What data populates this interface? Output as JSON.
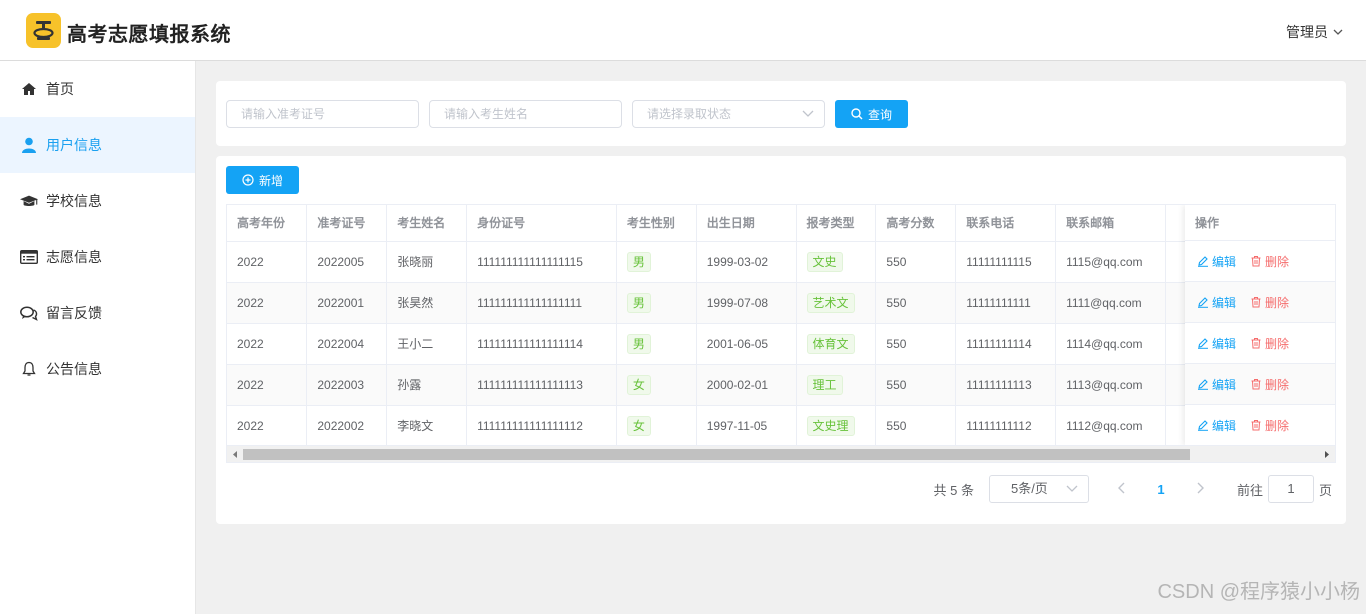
{
  "app": {
    "title": "高考志愿填报系统",
    "user": "管理员"
  },
  "sidebar": {
    "items": [
      {
        "label": "首页",
        "icon": "home-icon"
      },
      {
        "label": "用户信息",
        "icon": "user-icon",
        "active": true
      },
      {
        "label": "学校信息",
        "icon": "graduation-cap-icon"
      },
      {
        "label": "志愿信息",
        "icon": "list-card-icon"
      },
      {
        "label": "留言反馈",
        "icon": "chat-icon"
      },
      {
        "label": "公告信息",
        "icon": "bell-icon"
      }
    ]
  },
  "search": {
    "exam_no_placeholder": "请输入准考证号",
    "name_placeholder": "请输入考生姓名",
    "status_placeholder": "请选择录取状态",
    "search_label": "查询"
  },
  "toolbar": {
    "add_label": "新增"
  },
  "table": {
    "columns": [
      "高考年份",
      "准考证号",
      "考生姓名",
      "身份证号",
      "考生性别",
      "出生日期",
      "报考类型",
      "高考分数",
      "联系电话",
      "联系邮箱"
    ],
    "action_header": "操作",
    "edit_label": "编辑",
    "delete_label": "删除",
    "rows": [
      {
        "year": "2022",
        "exam_no": "2022005",
        "name": "张晓丽",
        "id_no": "111111111111111115",
        "gender": "男",
        "birth": "1999-03-02",
        "type": "文史",
        "score": "550",
        "phone": "11111111115",
        "email": "1115@qq.com"
      },
      {
        "year": "2022",
        "exam_no": "2022001",
        "name": "张昊然",
        "id_no": "111111111111111111",
        "gender": "男",
        "birth": "1999-07-08",
        "type": "艺术文",
        "score": "550",
        "phone": "11111111111",
        "email": "1111@qq.com"
      },
      {
        "year": "2022",
        "exam_no": "2022004",
        "name": "王小二",
        "id_no": "111111111111111114",
        "gender": "男",
        "birth": "2001-06-05",
        "type": "体育文",
        "score": "550",
        "phone": "11111111114",
        "email": "1114@qq.com"
      },
      {
        "year": "2022",
        "exam_no": "2022003",
        "name": "孙露",
        "id_no": "111111111111111113",
        "gender": "女",
        "birth": "2000-02-01",
        "type": "理工",
        "score": "550",
        "phone": "11111111113",
        "email": "1113@qq.com"
      },
      {
        "year": "2022",
        "exam_no": "2022002",
        "name": "李晓文",
        "id_no": "111111111111111112",
        "gender": "女",
        "birth": "1997-11-05",
        "type": "文史理",
        "score": "550",
        "phone": "11111111112",
        "email": "1112@qq.com"
      }
    ]
  },
  "pagination": {
    "total_text": "共 5 条",
    "page_size": "5条/页",
    "current_page": "1",
    "goto_prefix": "前往",
    "goto_value": "1",
    "goto_suffix": "页"
  },
  "watermark": "CSDN @程序猿小小杨",
  "colors": {
    "primary": "#14a3f5",
    "danger": "#f56c6c",
    "success": "#67c23a",
    "logo": "#f7c22a"
  }
}
